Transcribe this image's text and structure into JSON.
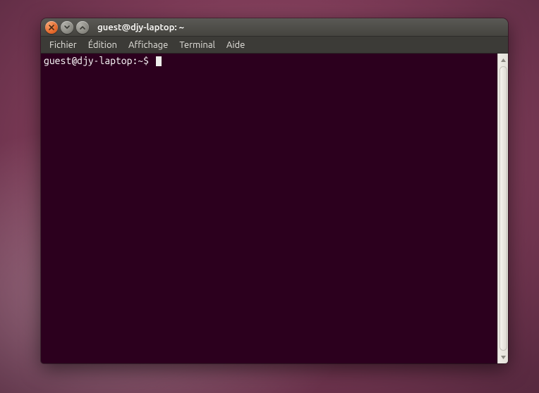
{
  "window": {
    "title": "guest@djy-laptop: ~"
  },
  "menubar": {
    "items": [
      "Fichier",
      "Édition",
      "Affichage",
      "Terminal",
      "Aide"
    ]
  },
  "terminal": {
    "prompt": "guest@djy-laptop:~$",
    "input": ""
  }
}
